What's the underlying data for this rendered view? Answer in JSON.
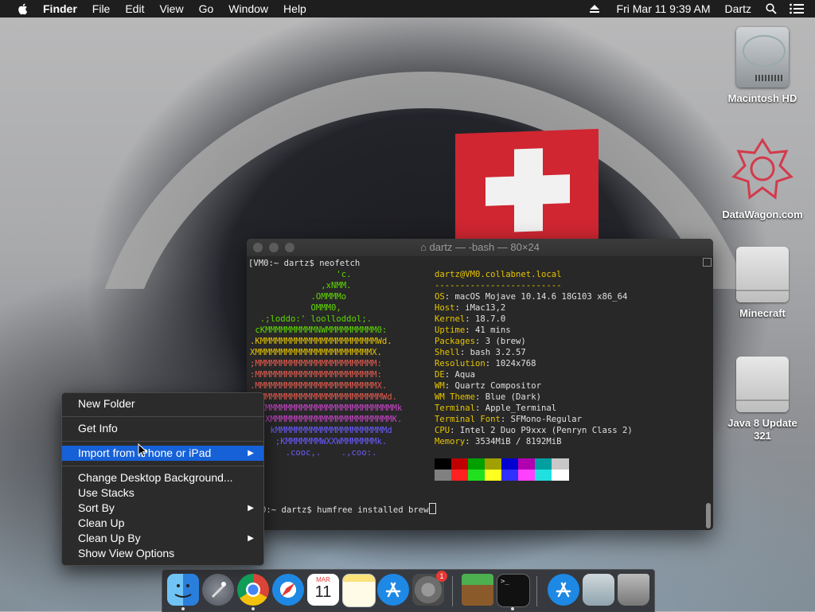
{
  "menubar": {
    "app": "Finder",
    "items": [
      "File",
      "Edit",
      "View",
      "Go",
      "Window",
      "Help"
    ],
    "datetime": "Fri Mar 11  9:39 AM",
    "user": "Dartz"
  },
  "desktop_icons": [
    "Macintosh HD",
    "DataWagon.com",
    "Minecraft",
    "Java 8 Update 321"
  ],
  "terminal": {
    "title": "dartz — -bash — 80×24",
    "prompt1": "[VM0:~ dartz$ neofetch",
    "logo": [
      "                 'c.",
      "              ,xNMM.",
      "            .OMMMMo",
      "            OMMM0,",
      "  .;loddo:' loolloddol;.",
      " cKMMMMMMMMMMNWMMMMMMMMMM0:",
      ".KMMMMMMMMMMMMMMMMMMMMMMMWd.",
      "XMMMMMMMMMMMMMMMMMMMMMMMX.",
      ";MMMMMMMMMMMMMMMMMMMMMMMM:",
      ":MMMMMMMMMMMMMMMMMMMMMMMM:",
      ".MMMMMMMMMMMMMMMMMMMMMMMMX.",
      " kMMMMMMMMMMMMMMMMMMMMMMMMWd.",
      " .XMMMMMMMMMMMMMMMMMMMMMMMMMMk",
      "  .XMMMMMMMMMMMMMMMMMMMMMMMMK.",
      "    kMMMMMMMMMMMMMMMMMMMMMMd",
      "     ;KMMMMMMMWXXWMMMMMMMk.",
      "       .cooc,.    .,coo:."
    ],
    "userhost_user": "dartz",
    "userhost_host": "@VM0.collabnet.local",
    "divider": "-------------------------",
    "info": [
      {
        "k": "OS",
        "v": "macOS Mojave 10.14.6 18G103 x86_64"
      },
      {
        "k": "Host",
        "v": "iMac13,2"
      },
      {
        "k": "Kernel",
        "v": "18.7.0"
      },
      {
        "k": "Uptime",
        "v": "41 mins"
      },
      {
        "k": "Packages",
        "v": "3 (brew)"
      },
      {
        "k": "Shell",
        "v": "bash 3.2.57"
      },
      {
        "k": "Resolution",
        "v": "1024x768"
      },
      {
        "k": "DE",
        "v": "Aqua"
      },
      {
        "k": "WM",
        "v": "Quartz Compositor"
      },
      {
        "k": "WM Theme",
        "v": "Blue (Dark)"
      },
      {
        "k": "Terminal",
        "v": "Apple_Terminal"
      },
      {
        "k": "Terminal Font",
        "v": "SFMono-Regular"
      },
      {
        "k": "CPU",
        "v": "Intel 2 Duo P9xxx (Penryn Class 2)"
      },
      {
        "k": "Memory",
        "v": "3534MiB / 8192MiB"
      }
    ],
    "prompt2": "0:~ dartz$ humfree installed brew",
    "logo_colors": [
      "#5fd700",
      "#5fd700",
      "#5fd700",
      "#5fd700",
      "#5fd700",
      "#5fd700",
      "#e6c400",
      "#e6c400",
      "#e65c4f",
      "#e65c4f",
      "#e65c4f",
      "#e65c4f",
      "#c945c9",
      "#c945c9",
      "#6a5cff",
      "#6a5cff",
      "#6a5cff"
    ],
    "swatches_top": [
      "#000000",
      "#c00000",
      "#00a000",
      "#a0a000",
      "#0000d0",
      "#b000b0",
      "#00a0a0",
      "#c8c8c8"
    ],
    "swatches_bottom": [
      "#808080",
      "#ff2020",
      "#20e020",
      "#ffff20",
      "#3030ff",
      "#ff40ff",
      "#20e0e0",
      "#ffffff"
    ]
  },
  "context_menu": {
    "items": [
      {
        "label": "New Folder"
      },
      {
        "label": "Get Info"
      },
      {
        "label": "Import from iPhone or iPad",
        "submenu": true,
        "selected": true
      },
      {
        "label": "Change Desktop Background..."
      },
      {
        "label": "Use Stacks"
      },
      {
        "label": "Sort By",
        "submenu": true
      },
      {
        "label": "Clean Up"
      },
      {
        "label": "Clean Up By",
        "submenu": true
      },
      {
        "label": "Show View Options"
      }
    ]
  },
  "dock": {
    "apps": [
      "Finder",
      "Launchpad",
      "Chrome",
      "Safari",
      "Calendar",
      "Notes",
      "App Store",
      "System Preferences",
      "Minecraft",
      "Terminal",
      "App Store Downloads",
      "Preview",
      "Trash"
    ],
    "calendar_month": "MAR",
    "calendar_day": "11",
    "badge": "1"
  },
  "colors": {
    "accent": "#1661d8",
    "info_key": "#e6c400"
  }
}
